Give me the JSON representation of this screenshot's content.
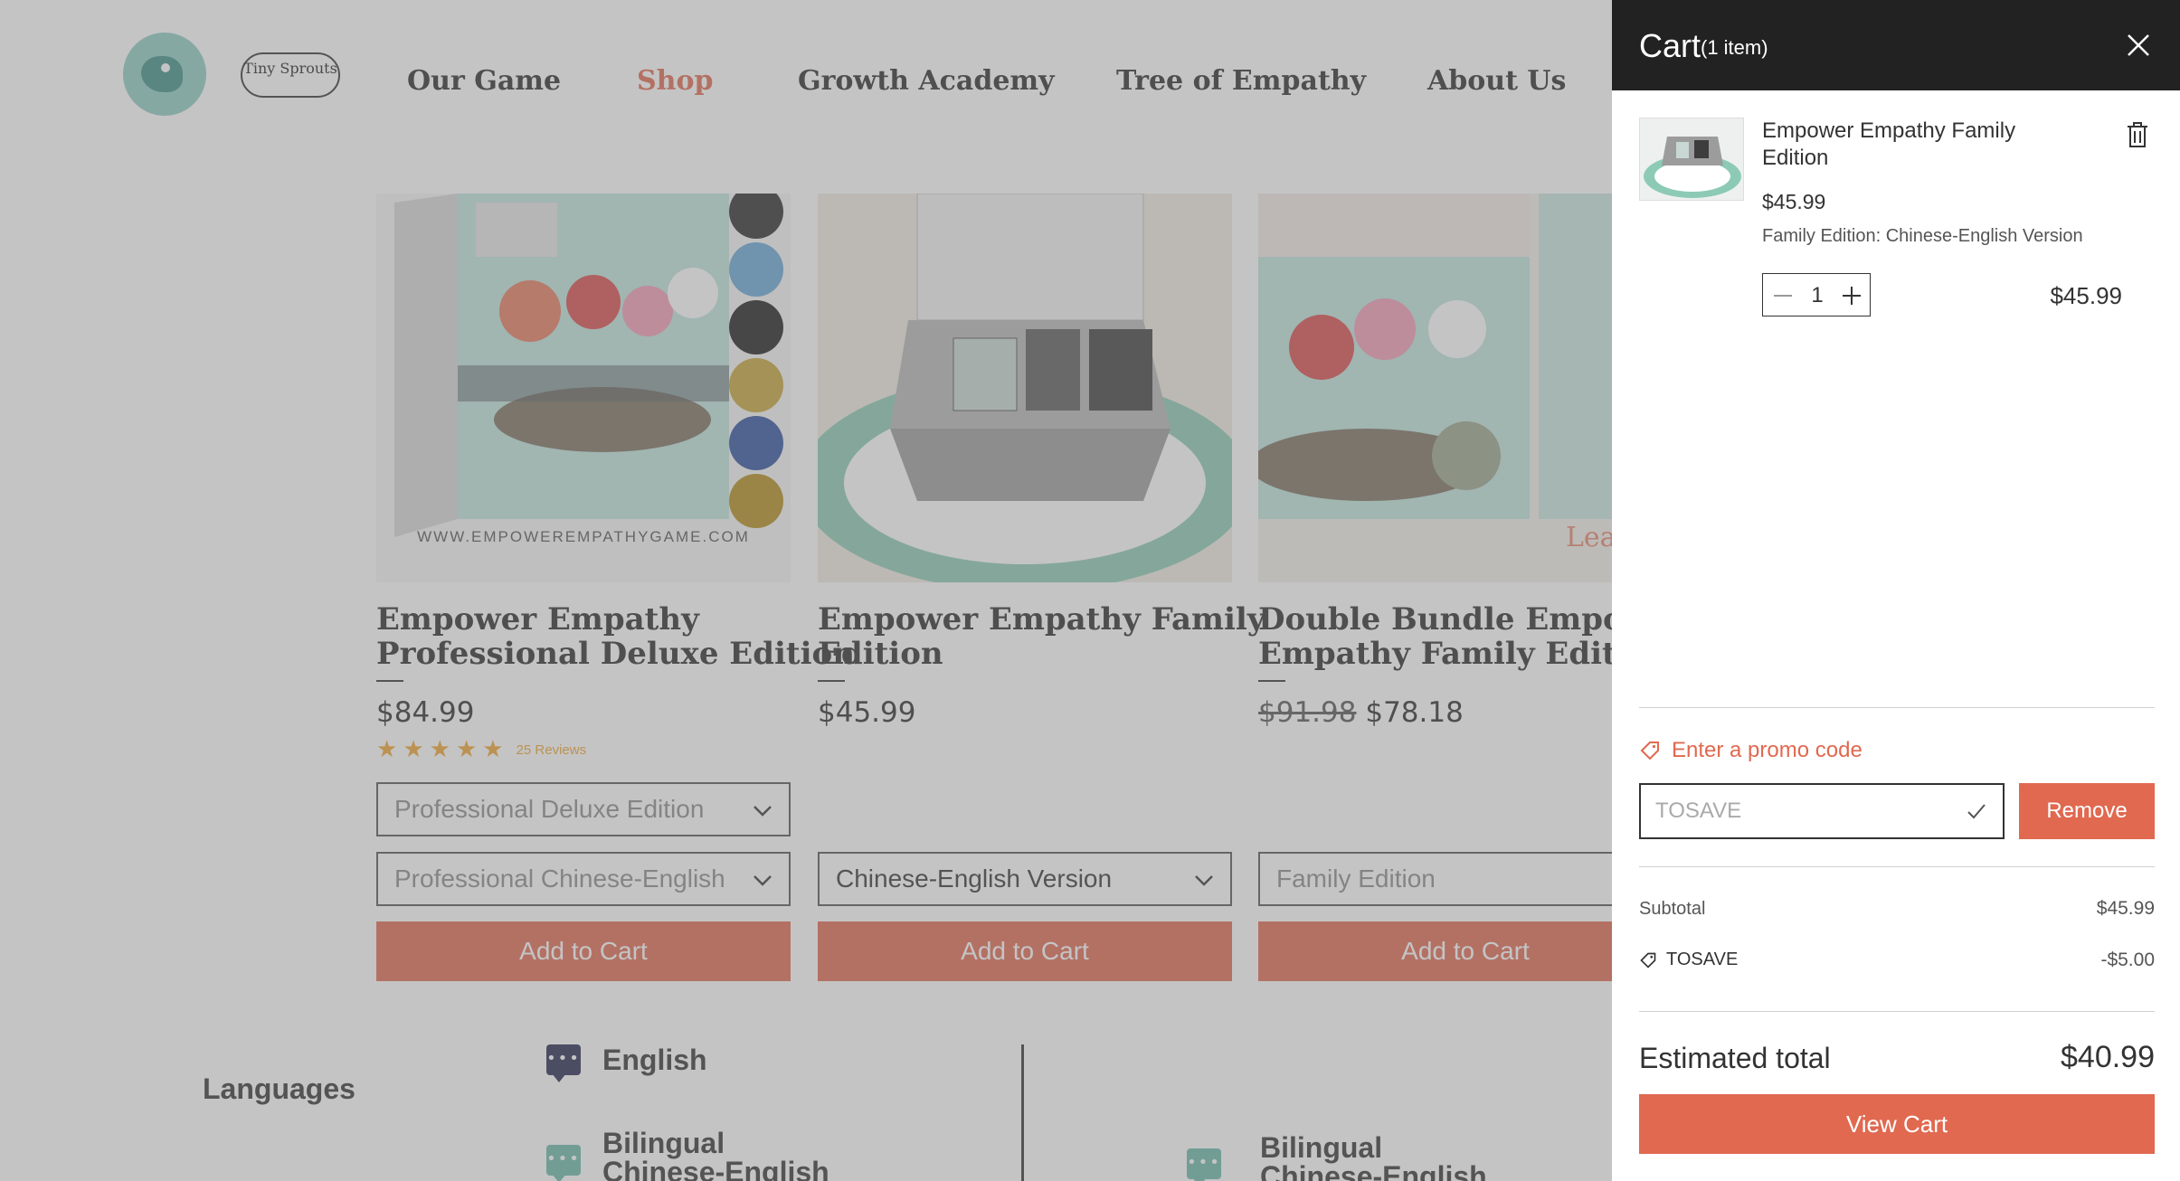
{
  "header": {
    "logo_text": "Tiny Sprouts",
    "nav": [
      {
        "label": "Our Game"
      },
      {
        "label": "Shop"
      },
      {
        "label": "Growth Academy"
      },
      {
        "label": "Tree of Empathy"
      },
      {
        "label": "About Us"
      }
    ],
    "active_nav": "Shop"
  },
  "products": [
    {
      "title_line1": "Empower Empathy",
      "title_line2": "Professional Deluxe Edition",
      "price": "$84.99",
      "rating": 5,
      "reviews": "25 Reviews",
      "image_caption": "WWW.EMPOWEREMPATHYGAME.COM",
      "select1": "Professional Deluxe Edition",
      "select2": "Professional Chinese-English",
      "add_to_cart": "Add to Cart"
    },
    {
      "title_line1": "Empower Empathy Family",
      "title_line2": "Edition",
      "price": "$45.99",
      "select2": "Chinese-English Version",
      "add_to_cart": "Add to Cart"
    },
    {
      "title_line1": "Double Bundle Empower",
      "title_line2": "Empathy Family Edition",
      "old_price": "$91.98",
      "price": "$78.18",
      "select2": "Family Edition",
      "add_to_cart": "Add to Cart"
    }
  ],
  "languages": {
    "heading": "Languages",
    "left_items": [
      {
        "label": "English"
      },
      {
        "label_line1": "Bilingual",
        "label_line2": "Chinese-English"
      }
    ],
    "right_items": [
      {
        "label_line1": "Bilingual",
        "label_line2": "Chinese-English"
      }
    ]
  },
  "cart": {
    "title": "Cart",
    "count": "(1  item)",
    "item": {
      "name": "Empower Empathy Family Edition",
      "price": "$45.99",
      "variant": "Family Edition: Chinese-English Version",
      "quantity": "1",
      "line_total": "$45.99"
    },
    "promo_link": "Enter a promo code",
    "promo_value": "TOSAVE",
    "remove_label": "Remove",
    "subtotal_label": "Subtotal",
    "subtotal_value": "$45.99",
    "discount_label": "TOSAVE",
    "discount_value": "-$5.00",
    "estimated_label": "Estimated total",
    "estimated_value": "$40.99",
    "view_cart": "View Cart"
  },
  "colors": {
    "accent": "#e06950",
    "header_dark": "#222222",
    "star": "#f0a531",
    "overlay": "rgba(125,125,125,0.45)"
  },
  "icons": [
    "close-icon",
    "trash-icon",
    "minus-icon",
    "plus-icon",
    "tag-icon",
    "check-icon",
    "chevron-down-icon",
    "chat-icon"
  ]
}
